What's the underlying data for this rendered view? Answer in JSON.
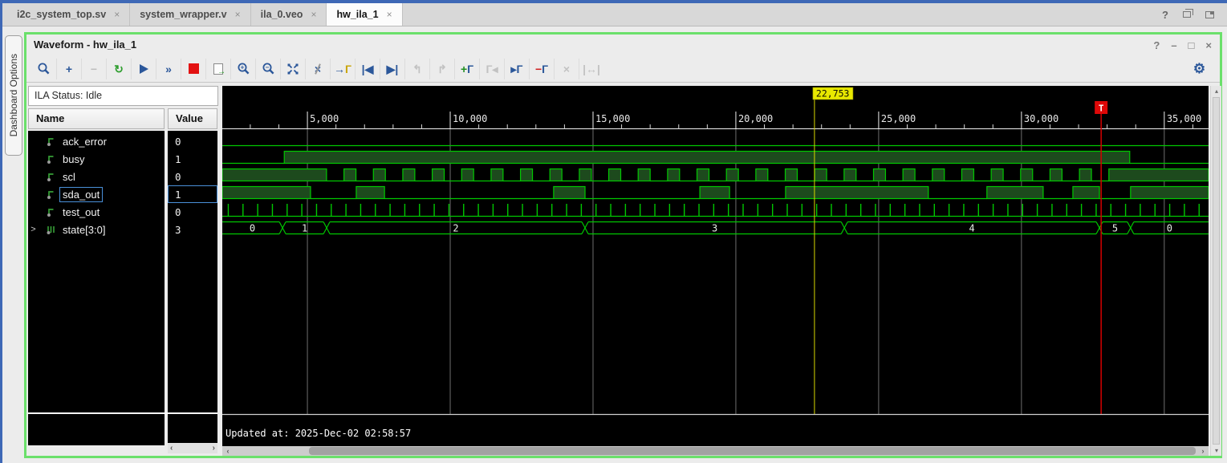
{
  "editor_tabs": {
    "tabs": [
      {
        "label": "i2c_system_top.sv",
        "active": false
      },
      {
        "label": "system_wrapper.v",
        "active": false
      },
      {
        "label": "ila_0.veo",
        "active": false
      },
      {
        "label": "hw_ila_1",
        "active": true
      }
    ],
    "close_glyph": "×",
    "window_icons": {
      "help": "?"
    }
  },
  "sidebar": {
    "dashboard_options_label": "Dashboard Options"
  },
  "waveform_window": {
    "title": "Waveform - hw_ila_1",
    "window_icons": {
      "help": "?",
      "minimize": "–",
      "maximize": "□",
      "close": "×"
    },
    "toolbar": {
      "items": [
        {
          "name": "find",
          "draw": "magnifier",
          "enabled": true
        },
        {
          "name": "add",
          "draw": "text",
          "parts": [
            {
              "t": "+",
              "c": "#2b579a"
            }
          ],
          "enabled": true
        },
        {
          "name": "remove",
          "draw": "text",
          "parts": [
            {
              "t": "−",
              "c": "#bdbdbd"
            }
          ],
          "enabled": false
        },
        {
          "name": "rerun-trigger",
          "draw": "text",
          "parts": [
            {
              "t": "↻",
              "c": "#2f9e2f"
            }
          ],
          "enabled": true
        },
        {
          "name": "run-trigger",
          "draw": "play",
          "enabled": true
        },
        {
          "name": "run-trigger-immediate",
          "draw": "text",
          "parts": [
            {
              "t": "»",
              "c": "#2b579a"
            }
          ],
          "enabled": true
        },
        {
          "name": "stop-trigger",
          "draw": "stop",
          "enabled": true
        },
        {
          "name": "export-data",
          "draw": "doc",
          "enabled": true
        },
        {
          "name": "zoom-in",
          "draw": "magnifier",
          "sign": "+",
          "enabled": true
        },
        {
          "name": "zoom-out",
          "draw": "magnifier",
          "sign": "−",
          "enabled": true
        },
        {
          "name": "zoom-fit",
          "draw": "fit",
          "enabled": true
        },
        {
          "name": "trigger-position",
          "draw": "slash-x",
          "enabled": true
        },
        {
          "name": "goto-trigger",
          "draw": "text",
          "parts": [
            {
              "t": "→",
              "c": "#2b579a"
            },
            {
              "t": "Г",
              "c": "#c9a50a"
            }
          ],
          "enabled": true
        },
        {
          "name": "goto-start",
          "draw": "text",
          "parts": [
            {
              "t": "|◀",
              "c": "#2b579a"
            }
          ],
          "enabled": true
        },
        {
          "name": "goto-end",
          "draw": "text",
          "parts": [
            {
              "t": "▶|",
              "c": "#2b579a"
            }
          ],
          "enabled": true
        },
        {
          "name": "previous-view",
          "draw": "text",
          "parts": [
            {
              "t": "↰",
              "c": "#c2c2c2"
            }
          ],
          "enabled": false
        },
        {
          "name": "next-view",
          "draw": "text",
          "parts": [
            {
              "t": "↱",
              "c": "#c2c2c2"
            }
          ],
          "enabled": false
        },
        {
          "name": "add-marker",
          "draw": "text",
          "parts": [
            {
              "t": "+",
              "c": "#1f8f1f"
            },
            {
              "t": "Г",
              "c": "#2b579a"
            }
          ],
          "enabled": true
        },
        {
          "name": "previous-marker",
          "draw": "text",
          "parts": [
            {
              "t": "Г",
              "c": "#c2c2c2"
            },
            {
              "t": "◂",
              "c": "#c2c2c2"
            }
          ],
          "enabled": false
        },
        {
          "name": "next-marker",
          "draw": "text",
          "parts": [
            {
              "t": "▸",
              "c": "#2b579a"
            },
            {
              "t": "Г",
              "c": "#2b579a"
            }
          ],
          "enabled": true
        },
        {
          "name": "delete-marker",
          "draw": "text",
          "parts": [
            {
              "t": "−",
              "c": "#cf1f1f"
            },
            {
              "t": "Г",
              "c": "#2b579a"
            }
          ],
          "enabled": true
        },
        {
          "name": "delete",
          "draw": "text",
          "parts": [
            {
              "t": "×",
              "c": "#c2c2c2"
            }
          ],
          "enabled": false
        },
        {
          "name": "swap-markers",
          "draw": "text",
          "parts": [
            {
              "t": "|↔|",
              "c": "#c2c2c2"
            }
          ],
          "enabled": false
        }
      ],
      "settings": {
        "name": "settings",
        "draw": "text",
        "parts": [
          {
            "t": "⚙",
            "c": "#2b579a"
          }
        ],
        "enabled": true
      }
    },
    "ila_status": "ILA Status: Idle",
    "table": {
      "columns": [
        "Name",
        "Value"
      ],
      "rows": [
        {
          "name": "ack_error",
          "value": "0",
          "kind": "bit",
          "selected": false,
          "expandable": false
        },
        {
          "name": "busy",
          "value": "1",
          "kind": "bit",
          "selected": false,
          "expandable": false
        },
        {
          "name": "scl",
          "value": "0",
          "kind": "bit",
          "selected": false,
          "expandable": false
        },
        {
          "name": "sda_out",
          "value": "1",
          "kind": "bit",
          "selected": true,
          "expandable": false
        },
        {
          "name": "test_out",
          "value": "0",
          "kind": "bit",
          "selected": false,
          "expandable": false
        },
        {
          "name": "state[3:0]",
          "value": "3",
          "kind": "bus",
          "selected": false,
          "expandable": true
        }
      ]
    },
    "status_bar": {
      "updated_at": "Updated at: 2025-Dec-02 02:58:57"
    }
  },
  "waveform": {
    "colors": {
      "trace": "#00c800",
      "fill": "#1d4a1d",
      "cursor": "#e8e800",
      "trigger": "#d40000",
      "grid": "#6e6e6e",
      "ruler_text": "#e8e8e8",
      "selection": "#4a90d9"
    },
    "time": {
      "start": 2020,
      "end": 36550,
      "minor_tick": 1000,
      "major_tick": 5000,
      "majors": [
        {
          "t": 5000,
          "label": "5,000"
        },
        {
          "t": 10000,
          "label": "10,000"
        },
        {
          "t": 15000,
          "label": "15,000"
        },
        {
          "t": 20000,
          "label": "20,000"
        },
        {
          "t": 25000,
          "label": "25,000"
        },
        {
          "t": 30000,
          "label": "30,000"
        },
        {
          "t": 35000,
          "label": "35,000"
        }
      ]
    },
    "markers": [
      {
        "type": "cursor",
        "time": 22753,
        "label": "22,753"
      },
      {
        "type": "trigger",
        "time": 32790,
        "label": "T"
      }
    ],
    "signals": [
      {
        "name": "ack_error",
        "kind": "bit",
        "initial": 0,
        "edges": []
      },
      {
        "name": "busy",
        "kind": "bit",
        "initial": 0,
        "edges": [
          {
            "t": 4190,
            "v": 1
          },
          {
            "t": 33790,
            "v": 0
          }
        ]
      },
      {
        "name": "scl",
        "kind": "clock",
        "initial": 1,
        "first_fall": 5670,
        "period": 1030,
        "low_width": 610,
        "cycles": 27
      },
      {
        "name": "sda_out",
        "kind": "bit",
        "initial": 1,
        "edges": [
          {
            "t": 5110,
            "v": 0
          },
          {
            "t": 6710,
            "v": 1
          },
          {
            "t": 7700,
            "v": 0
          },
          {
            "t": 13620,
            "v": 1
          },
          {
            "t": 14720,
            "v": 0
          },
          {
            "t": 18740,
            "v": 1
          },
          {
            "t": 19780,
            "v": 0
          },
          {
            "t": 21740,
            "v": 1
          },
          {
            "t": 26740,
            "v": 0
          },
          {
            "t": 28790,
            "v": 1
          },
          {
            "t": 30760,
            "v": 0
          },
          {
            "t": 31800,
            "v": 1
          },
          {
            "t": 32730,
            "v": 0
          },
          {
            "t": 33820,
            "v": 1
          }
        ]
      },
      {
        "name": "test_out",
        "kind": "pulses",
        "start": 2230,
        "period": 515
      },
      {
        "name": "state[3:0]",
        "kind": "bus",
        "segments": [
          {
            "from": 2020,
            "to": 4130,
            "label": "0"
          },
          {
            "from": 4130,
            "to": 5674,
            "label": "1"
          },
          {
            "from": 5674,
            "to": 14720,
            "label": "2"
          },
          {
            "from": 14720,
            "to": 23800,
            "label": "3"
          },
          {
            "from": 23800,
            "to": 32730,
            "label": "4"
          },
          {
            "from": 32730,
            "to": 33820,
            "label": "5"
          },
          {
            "from": 33820,
            "to": 36550,
            "label": "0"
          }
        ]
      }
    ]
  }
}
